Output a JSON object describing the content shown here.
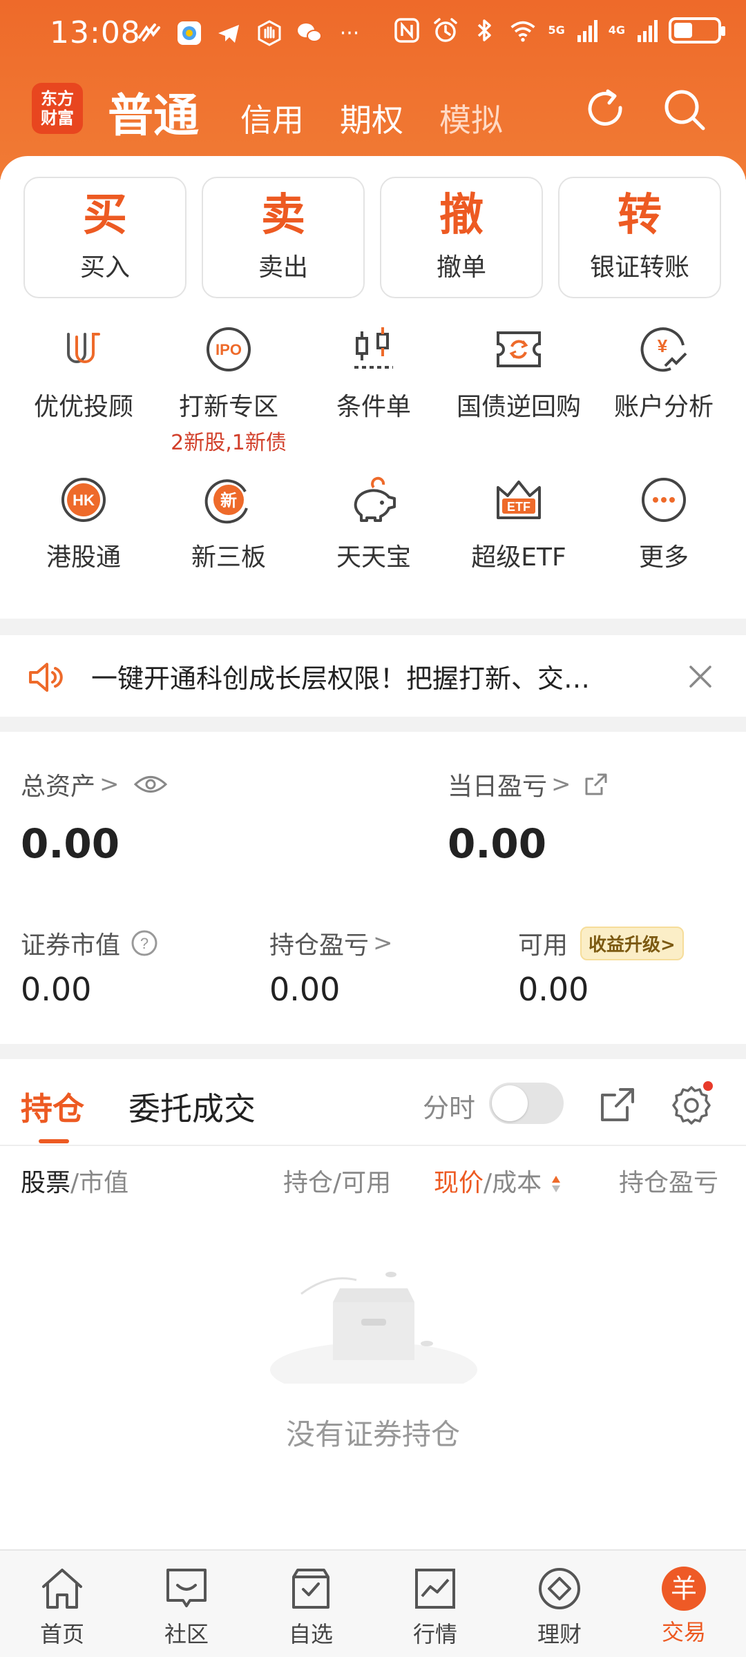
{
  "status_bar": {
    "time": "13:08",
    "network_5g": "5G",
    "network_4g": "4G",
    "more_icon_text": "···"
  },
  "header": {
    "logo_text_line1": "东方",
    "logo_text_line2": "财富",
    "tabs": [
      "普通",
      "信用",
      "期权",
      "模拟"
    ],
    "active_tab": "普通",
    "accent_color": "#EE6A2A"
  },
  "quick_actions": [
    {
      "char": "买",
      "label": "买入"
    },
    {
      "char": "卖",
      "label": "卖出"
    },
    {
      "char": "撤",
      "label": "撤单"
    },
    {
      "char": "转",
      "label": "银证转账"
    }
  ],
  "features": [
    {
      "label": "优优投顾",
      "icon": "uu-advisor-icon"
    },
    {
      "label": "打新专区",
      "icon": "ipo-icon",
      "sub": "2新股,1新债"
    },
    {
      "label": "条件单",
      "icon": "candlestick-icon"
    },
    {
      "label": "国债逆回购",
      "icon": "ticket-exchange-icon"
    },
    {
      "label": "账户分析",
      "icon": "yen-chart-icon"
    },
    {
      "label": "港股通",
      "icon": "hk-icon"
    },
    {
      "label": "新三板",
      "icon": "new-board-icon"
    },
    {
      "label": "天天宝",
      "icon": "piggy-bank-icon"
    },
    {
      "label": "超级ETF",
      "icon": "etf-crown-icon"
    },
    {
      "label": "更多",
      "icon": "more-icon"
    }
  ],
  "ipo_icon_text": "IPO",
  "hk_icon_text": "HK",
  "xin_icon_text": "新",
  "etf_icon_text": "ETF",
  "yen_icon_text": "¥",
  "notice": {
    "text": "一键开通科创成长层权限！把握打新、交…"
  },
  "assets": {
    "total_label": "总资产",
    "total_value": "0.00",
    "daily_pl_label": "当日盈亏",
    "daily_pl_value": "0.00",
    "market_value_label": "证券市值",
    "market_value": "0.00",
    "position_pl_label": "持仓盈亏",
    "position_pl_value": "0.00",
    "available_label": "可用",
    "available_value": "0.00",
    "upgrade_badge": "收益升级>",
    "help_icon_text": "?",
    "chevron": ">"
  },
  "positions": {
    "tab_holdings": "持仓",
    "tab_orders": "委托成交",
    "fenshi_label": "分时",
    "col_stock": "股票",
    "col_market_value": "/市值",
    "col_holding": "持仓/可用",
    "col_price": "现价",
    "col_cost": "/成本",
    "col_pl": "持仓盈亏",
    "empty_text": "没有证券持仓"
  },
  "bottom_nav": [
    {
      "label": "首页",
      "icon": "home-icon"
    },
    {
      "label": "社区",
      "icon": "community-icon"
    },
    {
      "label": "自选",
      "icon": "watchlist-icon"
    },
    {
      "label": "行情",
      "icon": "market-chart-icon"
    },
    {
      "label": "理财",
      "icon": "wealth-diamond-icon"
    },
    {
      "label": "交易",
      "icon": "trade-yuan-icon",
      "active": true
    }
  ],
  "trade_icon_text": "羊"
}
